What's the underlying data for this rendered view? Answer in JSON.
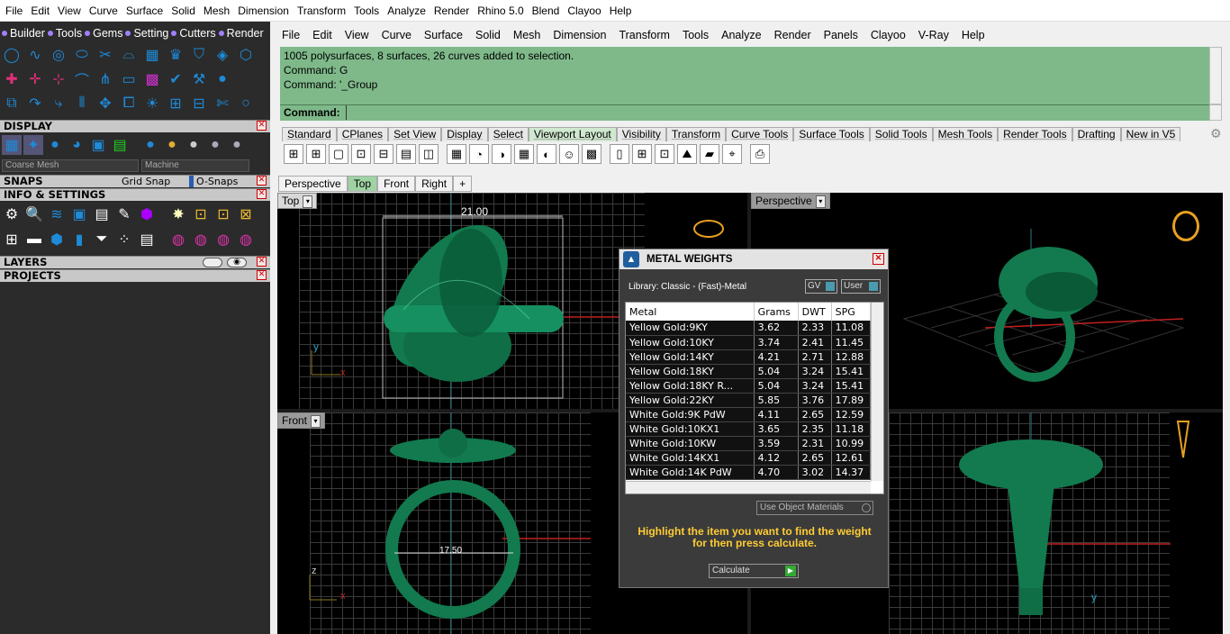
{
  "top_menu": [
    "File",
    "Edit",
    "View",
    "Curve",
    "Surface",
    "Solid",
    "Mesh",
    "Dimension",
    "Transform",
    "Tools",
    "Analyze",
    "Render",
    "Rhino 5.0",
    "Blend",
    "Clayoo",
    "Help"
  ],
  "left_panel": {
    "gem_tabs": [
      "Builder",
      "Tools",
      "Gems",
      "Setting",
      "Cutters",
      "Render"
    ],
    "sections": {
      "display": "DISPLAY",
      "snaps": "SNAPS",
      "info": "INFO & SETTINGS",
      "layers": "LAYERS",
      "projects": "PROJECTS"
    },
    "display_combo_left": "Coarse Mesh",
    "display_combo_right": "Machine",
    "grid_snap": "Grid Snap",
    "osnaps": "O-Snaps"
  },
  "main_menu": [
    "File",
    "Edit",
    "View",
    "Curve",
    "Surface",
    "Solid",
    "Mesh",
    "Dimension",
    "Transform",
    "Tools",
    "Analyze",
    "Render",
    "Panels",
    "Clayoo",
    "V-Ray",
    "Help"
  ],
  "command_history": [
    "1005 polysurfaces, 8 surfaces, 26 curves added to selection.",
    "Command: G",
    "Command: '_Group"
  ],
  "command_prompt": "Command:",
  "toolbar_tabs": [
    "Standard",
    "CPlanes",
    "Set View",
    "Display",
    "Select",
    "Viewport Layout",
    "Visibility",
    "Transform",
    "Curve Tools",
    "Surface Tools",
    "Solid Tools",
    "Mesh Tools",
    "Render Tools",
    "Drafting",
    "New in V5"
  ],
  "active_toolbar_tab": "Viewport Layout",
  "viewport_tabs": [
    "Perspective",
    "Top",
    "Front",
    "Right",
    "+"
  ],
  "viewports": {
    "top": "Top",
    "front": "Front",
    "perspective": "Perspective"
  },
  "dimensions": {
    "top_width": "21.00",
    "front_width": "17.50"
  },
  "axis_labels": {
    "y": "y",
    "x": "x",
    "z": "z"
  },
  "metal_weights": {
    "title": "METAL WEIGHTS",
    "library": "Library: Classic - (Fast)-Metal",
    "gv": "GV",
    "user": "User",
    "columns": [
      "Metal",
      "Grams",
      "DWT",
      "SPG"
    ],
    "rows": [
      [
        "Yellow Gold:9KY",
        "3.62",
        "2.33",
        "11.08"
      ],
      [
        "Yellow Gold:10KY",
        "3.74",
        "2.41",
        "11.45"
      ],
      [
        "Yellow Gold:14KY",
        "4.21",
        "2.71",
        "12.88"
      ],
      [
        "Yellow Gold:18KY",
        "5.04",
        "3.24",
        "15.41"
      ],
      [
        "Yellow Gold:18KY R...",
        "5.04",
        "3.24",
        "15.41"
      ],
      [
        "Yellow Gold:22KY",
        "5.85",
        "3.76",
        "17.89"
      ],
      [
        "White Gold:9K PdW",
        "4.11",
        "2.65",
        "12.59"
      ],
      [
        "White Gold:10KX1",
        "3.65",
        "2.35",
        "11.18"
      ],
      [
        "White Gold:10KW",
        "3.59",
        "2.31",
        "10.99"
      ],
      [
        "White Gold:14KX1",
        "4.12",
        "2.65",
        "12.61"
      ],
      [
        "White Gold:14K PdW",
        "4.70",
        "3.02",
        "14.37"
      ]
    ],
    "use_object_materials": "Use Object Materials",
    "hint": "Highlight the item you want to find the weight for then press calculate.",
    "calculate": "Calculate"
  },
  "colors": {
    "command_bg": "#7fb98a",
    "model": "#1a8a5a",
    "panel_dark": "#2b2b2b",
    "hint": "#ffcc33"
  }
}
